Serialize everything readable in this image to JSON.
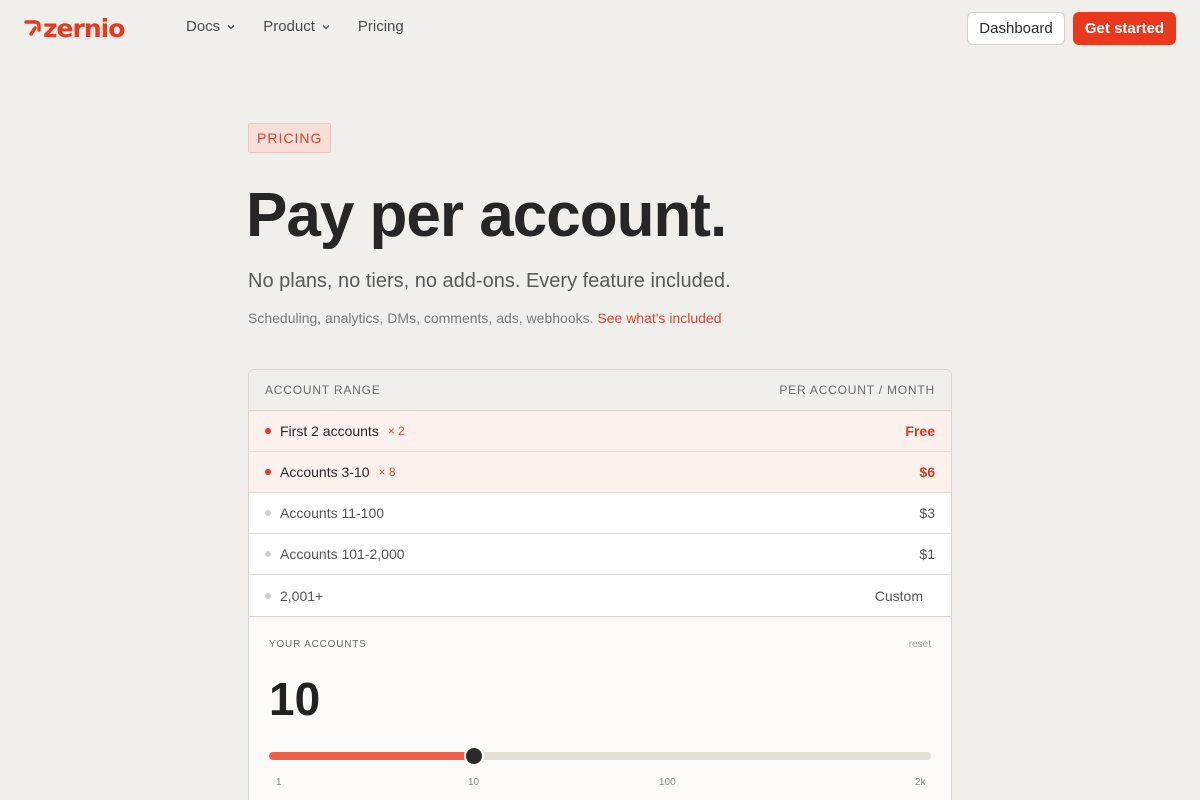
{
  "nav": {
    "logo_text": "zernio",
    "links": [
      {
        "label": "Docs",
        "dropdown": true
      },
      {
        "label": "Product",
        "dropdown": true
      },
      {
        "label": "Pricing",
        "dropdown": false
      }
    ],
    "dashboard_label": "Dashboard",
    "get_started_label": "Get started"
  },
  "hero": {
    "eyebrow": "PRICING",
    "headline": "Pay per account.",
    "subhead": "No plans, no tiers, no add-ons. Every feature included.",
    "features_text": "Scheduling, analytics, DMs, comments, ads, webhooks.",
    "features_link": "See what's included"
  },
  "pricing_table": {
    "header_left": "ACCOUNT RANGE",
    "header_right": "PER ACCOUNT / MONTH",
    "rows": [
      {
        "label": "First 2 accounts",
        "multiplier": "× 2",
        "price": "Free",
        "active": true
      },
      {
        "label": "Accounts 3-10",
        "multiplier": "× 8",
        "price": "$6",
        "active": true
      },
      {
        "label": "Accounts 11-100",
        "multiplier": "",
        "price": "$3",
        "active": false
      },
      {
        "label": "Accounts 101-2,000",
        "multiplier": "",
        "price": "$1",
        "active": false
      },
      {
        "label": "2,001+",
        "multiplier": "",
        "price": "Custom",
        "active": false
      }
    ]
  },
  "calculator": {
    "label": "YOUR ACCOUNTS",
    "reset_label": "reset",
    "value": "10",
    "slider_fraction": 0.309,
    "ticks": [
      "1",
      "10",
      "100",
      "2k"
    ]
  },
  "colors": {
    "accent": "#e8381e",
    "background": "#f1efeb",
    "slider_fill": "#ee6148"
  }
}
